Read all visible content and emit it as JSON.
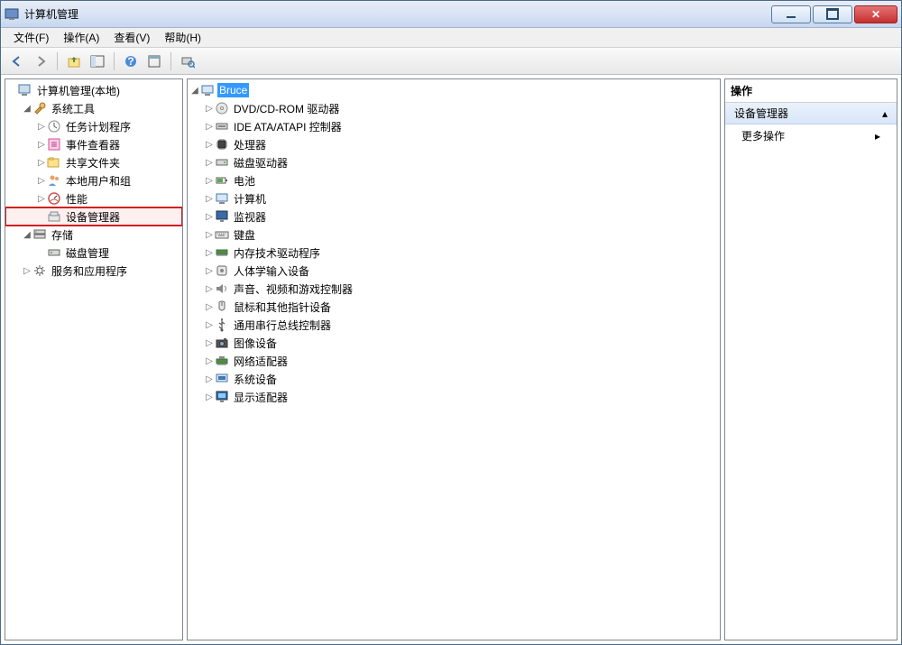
{
  "window": {
    "title": "计算机管理"
  },
  "menu": {
    "file": "文件(F)",
    "action": "操作(A)",
    "view": "查看(V)",
    "help": "帮助(H)"
  },
  "left_tree": {
    "root": "计算机管理(本地)",
    "system_tools": "系统工具",
    "task_scheduler": "任务计划程序",
    "event_viewer": "事件查看器",
    "shared_folders": "共享文件夹",
    "local_users": "本地用户和组",
    "performance": "性能",
    "device_manager": "设备管理器",
    "storage": "存储",
    "disk_mgmt": "磁盘管理",
    "services_apps": "服务和应用程序"
  },
  "mid_tree": {
    "root": "Bruce",
    "items": [
      "DVD/CD-ROM 驱动器",
      "IDE ATA/ATAPI 控制器",
      "处理器",
      "磁盘驱动器",
      "电池",
      "计算机",
      "监视器",
      "键盘",
      "内存技术驱动程序",
      "人体学输入设备",
      "声音、视频和游戏控制器",
      "鼠标和其他指针设备",
      "通用串行总线控制器",
      "图像设备",
      "网络适配器",
      "系统设备",
      "显示适配器"
    ]
  },
  "actions": {
    "header": "操作",
    "section": "设备管理器",
    "more": "更多操作"
  }
}
